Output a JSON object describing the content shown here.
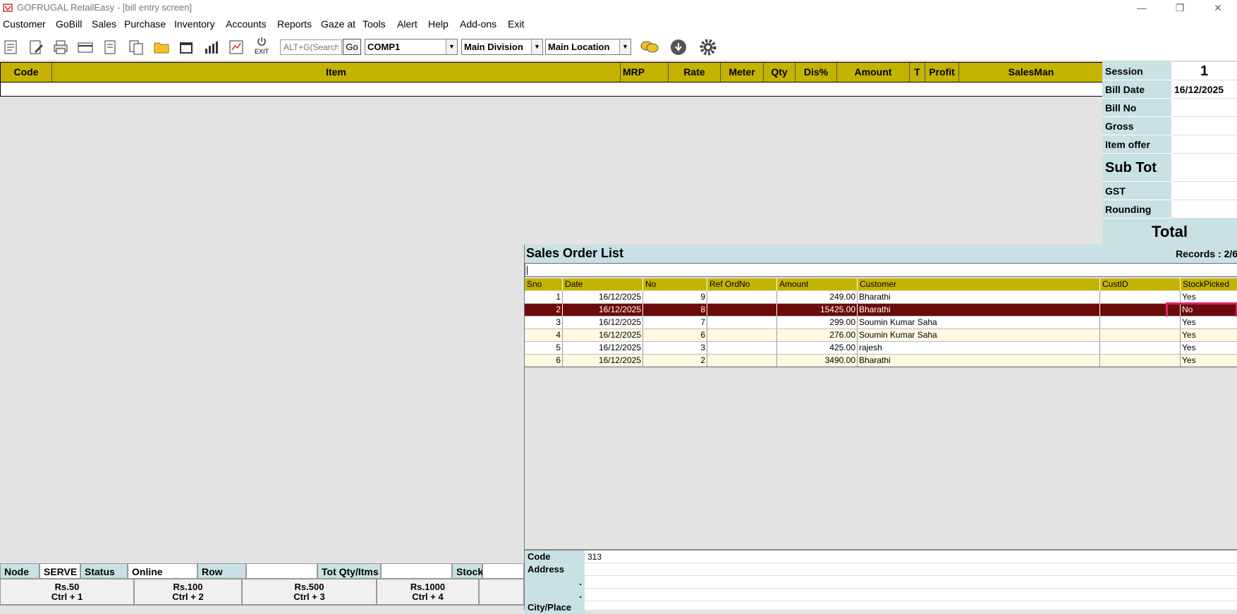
{
  "window": {
    "title": "GOFRUGAL RetailEasy - [bill entry screen]",
    "minimize_glyph": "—",
    "restore_glyph": "❐",
    "close_glyph": "✕"
  },
  "menu": [
    "Customer",
    "GoBill",
    "Sales",
    "Purchase",
    "Inventory",
    "Accounts",
    "Reports",
    "Gaze at",
    "Tools",
    "Alert",
    "Help",
    "Add-ons",
    "Exit"
  ],
  "toolbar": {
    "exit_label": "EXIT",
    "search_placeholder": "ALT+G(Search)",
    "go_label": "Go",
    "company": "COMP1",
    "division": "Main Division",
    "location": "Main Location"
  },
  "grid": {
    "columns": [
      "Code",
      "Item",
      "MRP",
      "Rate",
      "Meter",
      "Qty",
      "Dis%",
      "Amount",
      "T",
      "Profit",
      "SalesMan"
    ]
  },
  "summary": {
    "session_label": "Session",
    "session_value": "1",
    "bill_date_label": "Bill Date",
    "bill_date_value": "16/12/2025",
    "bill_no_label": "Bill No",
    "gross_label": "Gross",
    "item_offer_label": "Item offer",
    "sub_tot_label": "Sub Tot",
    "gst_label": "GST",
    "rounding_label": "Rounding",
    "total_label": "Total"
  },
  "sales_order": {
    "title": "Sales Order List",
    "records": "Records : 2/6",
    "columns": [
      "Sno",
      "Date",
      "No",
      "Ref OrdNo",
      "Amount",
      "Customer",
      "CustID",
      "StockPicked"
    ],
    "rows": [
      {
        "sno": "1",
        "date": "16/12/2025",
        "no": "9",
        "ref": "",
        "amount": "249.00",
        "customer": "Bharathi",
        "custid": "",
        "stock": "Yes"
      },
      {
        "sno": "2",
        "date": "16/12/2025",
        "no": "8",
        "ref": "",
        "amount": "15425.00",
        "customer": "Bharathi",
        "custid": "",
        "stock": "No"
      },
      {
        "sno": "3",
        "date": "16/12/2025",
        "no": "7",
        "ref": "",
        "amount": "299.00",
        "customer": "Soumin Kumar Saha",
        "custid": "",
        "stock": "Yes"
      },
      {
        "sno": "4",
        "date": "16/12/2025",
        "no": "6",
        "ref": "",
        "amount": "276.00",
        "customer": "Soumin Kumar Saha",
        "custid": "",
        "stock": "Yes"
      },
      {
        "sno": "5",
        "date": "16/12/2025",
        "no": "3",
        "ref": "",
        "amount": "425.00",
        "customer": "rajesh",
        "custid": "",
        "stock": "Yes"
      },
      {
        "sno": "6",
        "date": "16/12/2025",
        "no": "2",
        "ref": "",
        "amount": "3490.00",
        "customer": "Bharathi",
        "custid": "",
        "stock": "Yes"
      }
    ],
    "detail": {
      "code_label": "Code",
      "code_value": "313",
      "address_label": "Address",
      "dot1": ".",
      "dot2": ".",
      "city_label": "City/Place"
    }
  },
  "status": {
    "node_label": "Node",
    "node_value": "SERVE",
    "status_label": "Status",
    "status_value": "Online",
    "row_label": "Row",
    "tot_label": "Tot Qty/Itms",
    "stock_label": "Stock"
  },
  "cash_buttons": [
    {
      "amount": "Rs.50",
      "shortcut": "Ctrl + 1"
    },
    {
      "amount": "Rs.100",
      "shortcut": "Ctrl + 2"
    },
    {
      "amount": "Rs.500",
      "shortcut": "Ctrl + 3"
    },
    {
      "amount": "Rs.1000",
      "shortcut": "Ctrl + 4"
    }
  ],
  "colors": {
    "header_olive": "#c4b300",
    "label_blue": "#c9e0e5",
    "selected_row": "#6b0b0b",
    "highlight_box": "#e0206a"
  }
}
